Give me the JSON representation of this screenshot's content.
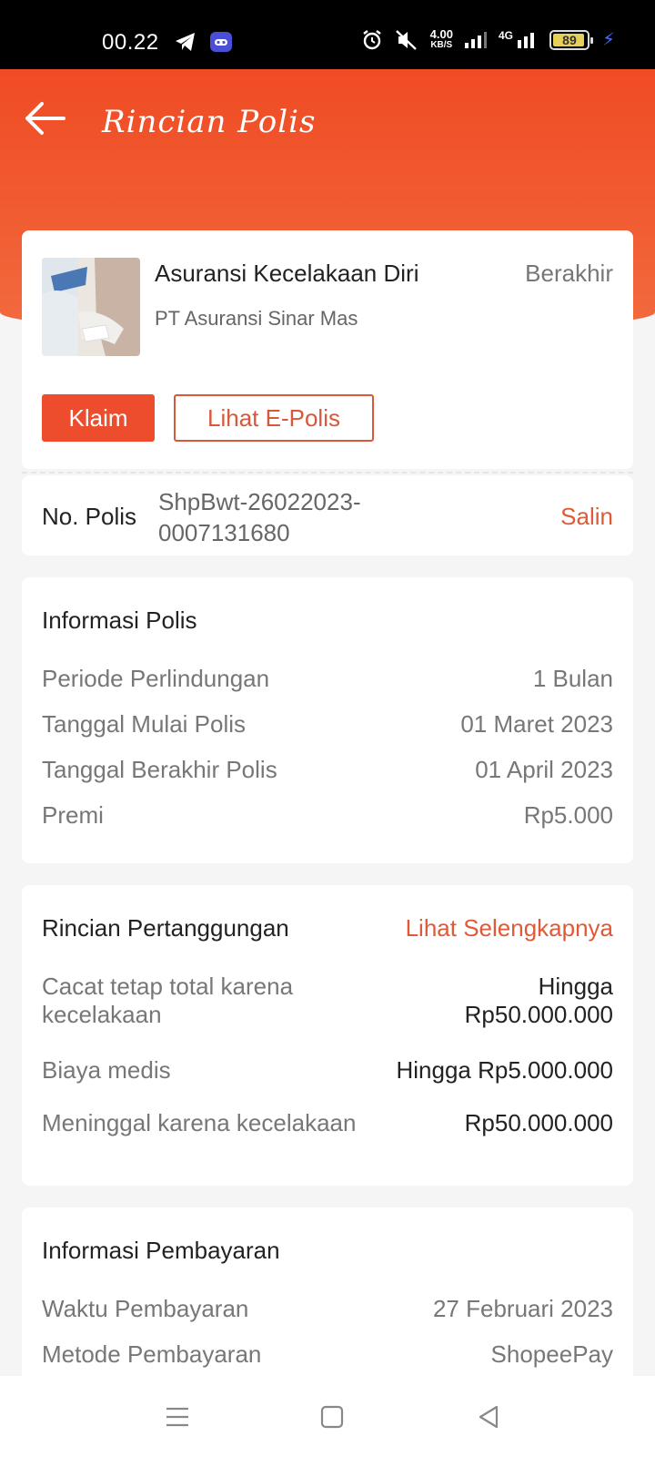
{
  "status_bar": {
    "time": "00.22",
    "speed_value": "4.00",
    "speed_unit": "KB/S",
    "network": "4G",
    "battery": "89",
    "icons": [
      "telegram-icon",
      "app-icon",
      "alarm-icon",
      "mute-icon",
      "signal-icon",
      "battery-icon",
      "charging-icon"
    ]
  },
  "header": {
    "title": "Rincian Polis",
    "back_icon": "back-arrow-icon"
  },
  "policy": {
    "product_name": "Asuransi Kecelakaan Diri",
    "status": "Berakhir",
    "company": "PT Asuransi Sinar Mas",
    "claim_label": "Klaim",
    "epolicy_label": "Lihat E-Polis",
    "policy_no_label": "No. Polis",
    "policy_no_line1": "ShpBwt-26022023-",
    "policy_no_line2": "0007131680",
    "copy_label": "Salin"
  },
  "policy_info": {
    "title": "Informasi Polis",
    "rows": [
      {
        "label": "Periode Perlindungan",
        "value": "1 Bulan"
      },
      {
        "label": "Tanggal Mulai Polis",
        "value": "01 Maret 2023"
      },
      {
        "label": "Tanggal Berakhir Polis",
        "value": "01 April 2023"
      },
      {
        "label": "Premi",
        "value": "Rp5.000"
      }
    ]
  },
  "coverage": {
    "title": "Rincian Pertanggungan",
    "more_label": "Lihat Selengkapnya",
    "rows": [
      {
        "label_line1": "Cacat tetap total karena",
        "label_line2": "kecelakaan",
        "value_line1": "Hingga",
        "value_line2": "Rp50.000.000"
      },
      {
        "label": "Biaya medis",
        "value": "Hingga Rp5.000.000"
      },
      {
        "label": "Meninggal karena kecelakaan",
        "value": "Rp50.000.000"
      }
    ]
  },
  "payment": {
    "title": "Informasi Pembayaran",
    "rows": [
      {
        "label": "Waktu Pembayaran",
        "value": "27 Februari 2023"
      },
      {
        "label": "Metode Pembayaran",
        "value": "ShopeePay"
      }
    ]
  },
  "nav": {
    "icons": [
      "menu-icon",
      "home-square-icon",
      "back-triangle-icon"
    ]
  }
}
